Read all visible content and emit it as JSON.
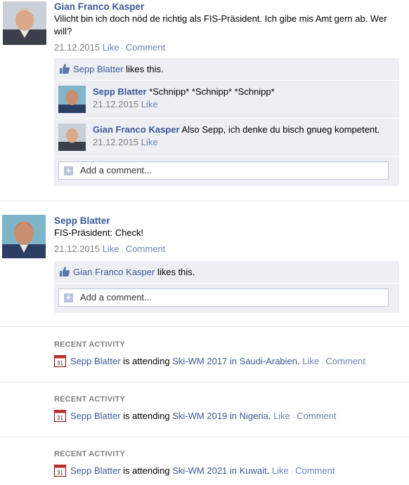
{
  "post1": {
    "author": "Gian Franco Kasper",
    "text": "Vilicht bin ich doch nöd de richtig als FIS-Präsident. Ich gibe mis Amt gern ab. Wer will?",
    "date": "21.12.2015",
    "like": "Like",
    "comment": "Comment",
    "likes_name": "Sepp Blatter",
    "likes_suffix": " likes this.",
    "comments": [
      {
        "author": "Sepp Blatter",
        "text": " *Schnipp* *Schnipp* *Schnipp*",
        "date": "21.12.2015",
        "like": "Like"
      },
      {
        "author": "Gian Franco Kasper",
        "text": " Also Sepp, ich denke du bisch gnueg kompetent.",
        "date": "21.12.2015",
        "like": "Like"
      }
    ],
    "add_comment": "Add a comment..."
  },
  "post2": {
    "author": "Sepp Blatter",
    "text": "FIS-Präsident: Check!",
    "date": "21.12.2015",
    "like": "Like",
    "comment": "Comment",
    "likes_name": "Gian Franco Kasper",
    "likes_suffix": " likes this.",
    "add_comment": "Add a comment..."
  },
  "activities": [
    {
      "title": "RECENT ACTIVITY",
      "calendar_day": "31",
      "person": "Sepp Blatter",
      "verb": " is attending ",
      "event": "Ski-WM 2017 in Saudi-Arabien",
      "period": ".",
      "like": "Like",
      "comment": "Comment"
    },
    {
      "title": "RECENT ACTIVITY",
      "calendar_day": "31",
      "person": "Sepp Blatter",
      "verb": " is attending ",
      "event": "Ski-WM 2019 in Nigeria",
      "period": ".",
      "like": "Like",
      "comment": "Comment"
    },
    {
      "title": "RECENT ACTIVITY",
      "calendar_day": "31",
      "person": "Sepp Blatter",
      "verb": " is attending ",
      "event": "Ski-WM 2021 in Kuwait",
      "period": ".",
      "like": "Like",
      "comment": "Comment"
    }
  ],
  "icons": {
    "like": "thumbs-up-icon",
    "event": "calendar-icon",
    "add": "plus-icon"
  },
  "colors": {
    "link": "#3b5998",
    "ufi_bg": "#edeff4",
    "muted": "#808080"
  }
}
